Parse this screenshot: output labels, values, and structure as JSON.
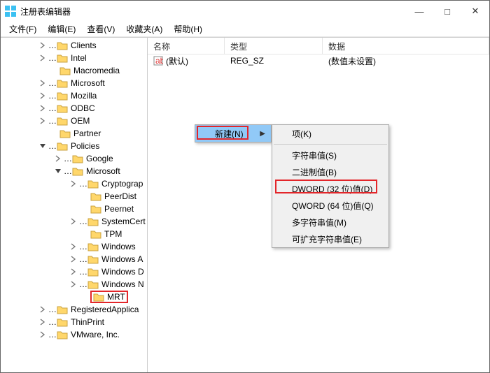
{
  "title": "注册表编辑器",
  "window_controls": {
    "min": "—",
    "max": "□",
    "close": "✕"
  },
  "menu": {
    "file": "文件(F)",
    "edit": "编辑(E)",
    "view": "查看(V)",
    "favorites": "收藏夹(A)",
    "help": "帮助(H)"
  },
  "tree": {
    "clients": "Clients",
    "intel": "Intel",
    "macromedia": "Macromedia",
    "microsoft": "Microsoft",
    "mozilla": "Mozilla",
    "odbc": "ODBC",
    "oem": "OEM",
    "partner": "Partner",
    "policies": "Policies",
    "google": "Google",
    "ms": "Microsoft",
    "crypto": "Cryptograp",
    "peerdist": "PeerDist",
    "peernet": "Peernet",
    "systemcert": "SystemCert",
    "tpm": "TPM",
    "windows": "Windows",
    "windowsa": "Windows A",
    "windowsd": "Windows D",
    "windowsn": "Windows N",
    "mrt": "MRT",
    "regapp": "RegisteredApplica",
    "thinprint": "ThinPrint",
    "vmware": "VMware, Inc."
  },
  "columns": {
    "name": "名称",
    "type": "类型",
    "data": "数据"
  },
  "default_row": {
    "name": "(默认)",
    "type": "REG_SZ",
    "data": "(数值未设置)"
  },
  "context": {
    "new": "新建(N)",
    "submenu": {
      "key": "项(K)",
      "string": "字符串值(S)",
      "binary": "二进制值(B)",
      "dword": "DWORD (32 位)值(D)",
      "qword": "QWORD (64 位)值(Q)",
      "multi": "多字符串值(M)",
      "expand": "可扩充字符串值(E)"
    }
  }
}
